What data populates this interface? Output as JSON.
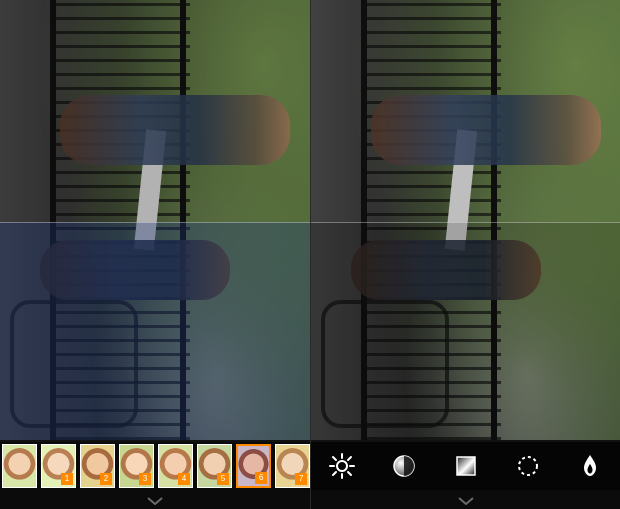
{
  "left_panel": {
    "filters": [
      {
        "name": "original",
        "badge": ""
      },
      {
        "name": "filter-1",
        "badge": "1"
      },
      {
        "name": "filter-2",
        "badge": "2"
      },
      {
        "name": "filter-3",
        "badge": "3"
      },
      {
        "name": "filter-4",
        "badge": "4"
      },
      {
        "name": "filter-5",
        "badge": "5"
      },
      {
        "name": "filter-6",
        "badge": "6",
        "selected": true
      },
      {
        "name": "filter-7",
        "badge": "7"
      }
    ],
    "chevron_icon": "chevron-down-icon"
  },
  "right_panel": {
    "tools": [
      {
        "name": "brightness-icon"
      },
      {
        "name": "contrast-icon"
      },
      {
        "name": "vignette-icon"
      },
      {
        "name": "blur-icon"
      },
      {
        "name": "saturation-icon"
      }
    ],
    "chevron_icon": "chevron-down-icon"
  },
  "colors": {
    "accent": "#ff8a00",
    "background": "#000000"
  }
}
